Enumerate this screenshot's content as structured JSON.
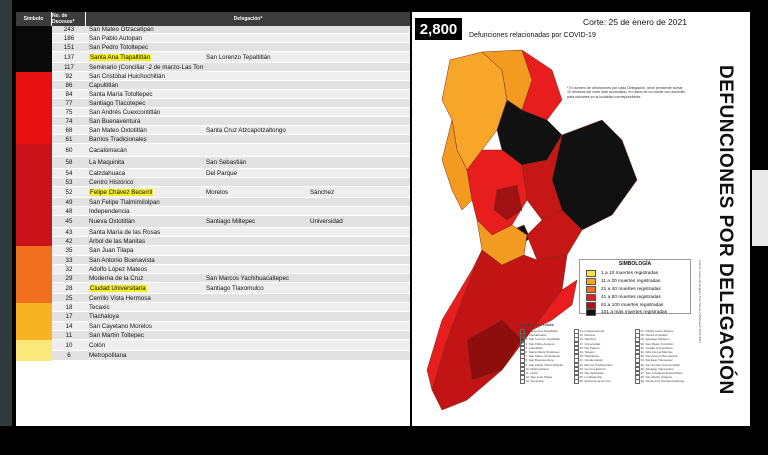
{
  "table": {
    "headers": [
      "Símbolo",
      "No. de Decesos*",
      "Delegación*"
    ],
    "rows": [
      {
        "n": "243",
        "c": [
          "San Mateo Otzacatipan",
          "",
          ""
        ]
      },
      {
        "n": "186",
        "c": [
          "San Pablo Autopan",
          "",
          ""
        ]
      },
      {
        "n": "151",
        "c": [
          "San Pedro Totoltepec",
          "",
          ""
        ]
      },
      {
        "n": "137",
        "c": [
          "Santa Ana Tlapaltitlán",
          "San Lorenzo Tepaltitlán",
          ""
        ],
        "hl": 0
      },
      {
        "n": "117",
        "c": [
          "Seminario (Conciliar -2 de marzo-Las Torres)",
          "",
          ""
        ]
      },
      {
        "n": "92",
        "c": [
          "San Cristóbal Huichochitlán",
          "",
          ""
        ]
      },
      {
        "n": "86",
        "c": [
          "Capultitlán",
          "",
          ""
        ]
      },
      {
        "n": "84",
        "c": [
          "Santa María Totoltepec",
          "",
          ""
        ]
      },
      {
        "n": "77",
        "c": [
          "Santiago Tlacotepec",
          "",
          ""
        ]
      },
      {
        "n": "75",
        "c": [
          "San Andrés Cuexcontitlán",
          "",
          ""
        ]
      },
      {
        "n": "74",
        "c": [
          "San Buenaventura",
          "",
          ""
        ]
      },
      {
        "n": "68",
        "c": [
          "San Mateo Oxtotitlán",
          "Santa Cruz Atzcapotzaltongo",
          ""
        ]
      },
      {
        "n": "61",
        "c": [
          "Barrios Tradicionales",
          "",
          ""
        ]
      },
      {
        "n": "60",
        "c": [
          "Cacalomacán",
          "",
          ""
        ]
      },
      {
        "n": "58",
        "c": [
          "La Maquinita",
          "San Sebastián",
          ""
        ]
      },
      {
        "n": "54",
        "c": [
          "Calzdahuaca",
          "Del Parque",
          ""
        ]
      },
      {
        "n": "53",
        "c": [
          "Centro Histórico",
          "",
          ""
        ]
      },
      {
        "n": "52",
        "c": [
          "Felipe Chávez Becerril",
          "Morelos",
          "Sánchez"
        ],
        "hl": 0
      },
      {
        "n": "49",
        "c": [
          "San Felipe Tlalmimilolpan",
          "",
          ""
        ]
      },
      {
        "n": "48",
        "c": [
          "Independencia",
          "",
          ""
        ]
      },
      {
        "n": "45",
        "c": [
          "Nueva Oxtotitlán",
          "Santiago Miltepec",
          "Universidad"
        ]
      },
      {
        "n": "43",
        "c": [
          "Santa María de las Rosas",
          "",
          ""
        ]
      },
      {
        "n": "42",
        "c": [
          "Árbol de las Manitas",
          "",
          ""
        ]
      },
      {
        "n": "35",
        "c": [
          "San Juan Tilapa",
          "",
          ""
        ]
      },
      {
        "n": "33",
        "c": [
          "San Antonio Buenavista",
          "",
          ""
        ]
      },
      {
        "n": "32",
        "c": [
          "Adolfo López Mateos",
          "",
          ""
        ]
      },
      {
        "n": "29",
        "c": [
          "Moderna de la Cruz",
          "San Marcos Yachihuacaltepec",
          ""
        ]
      },
      {
        "n": "28",
        "c": [
          "Ciudad Universitaria",
          "Santiago Tlaxomulco",
          ""
        ],
        "hl": 0
      },
      {
        "n": "25",
        "c": [
          "Cerrillo Vista Hermosa",
          "",
          ""
        ]
      },
      {
        "n": "18",
        "c": [
          "Tecaxic",
          "",
          ""
        ]
      },
      {
        "n": "17",
        "c": [
          "Tlachaloya",
          "",
          ""
        ]
      },
      {
        "n": "14",
        "c": [
          "San Cayetano Morelos",
          "",
          ""
        ]
      },
      {
        "n": "11",
        "c": [
          "San Martín Toltepec",
          "",
          ""
        ]
      },
      {
        "n": "10",
        "c": [
          "Colón",
          "",
          ""
        ]
      },
      {
        "n": "6",
        "c": [
          "Metropolitana",
          "",
          ""
        ]
      }
    ],
    "symbol_colors": [
      "#0a0a0a",
      "#e81010",
      "#c9121a",
      "#f07020",
      "#f7b324",
      "#fae87a"
    ]
  },
  "map": {
    "total": "2,800",
    "corte": "Corte: 25 de enero de 2021",
    "subtitle": "Defunciones relacionadas por COVID-19",
    "vertical_title": "DEFUNCIONES POR DELEGACIÓN",
    "source": "Fuente: Actas del Registro Civil Toluca y Manzana* 2019-2021",
    "note": "* El número de defunciones por cada Delegación, tiene pendiente sumar 10 decesos del corte total acumulado, en razón de no contar con domicilio para ubicarles en la localidad correspondiente."
  },
  "legend": {
    "title": "SIMBOLOGÍA",
    "items": [
      {
        "label": "1 a 10 muertes registradas",
        "color": "#f7e04a"
      },
      {
        "label": "11 a 20 muertes registradas",
        "color": "#f7a62a"
      },
      {
        "label": "21 a 40 muertes registradas",
        "color": "#f37021"
      },
      {
        "label": "41 a 60 muertes registradas",
        "color": "#e81d1d"
      },
      {
        "label": "61 a 100 muertes registradas",
        "color": "#b41212"
      },
      {
        "label": "101 a más muertes registradas",
        "color": "#111111"
      }
    ]
  },
  "index": {
    "title": "Delegaciones Toluca",
    "columns": [
      [
        "1. Santa Ana Tlapaltitlán",
        "2. Calzdahuaca",
        "3. San Lorenzo Tepaltitlán",
        "4. San Pablo Autopan",
        "5. Capultitlán",
        "6. Santa María Totoltepec",
        "7. San Mateo Otzacatipan",
        "8. San Buenaventura",
        "9. San Felipe Tlalmimilolpan",
        "10. Metropolitana",
        "11. Colón",
        "12. San Juan Tilapa",
        "13. Seminario"
      ],
      [
        "14. Independencia",
        "15. Morelos",
        "16. Sánchez",
        "17. Universidad",
        "18. Del Parque",
        "19. Tecaxic",
        "20. Tlachaloya",
        "21. Cacalomacán",
        "22. Barrios Tradicionales",
        "23. Centro Histórico",
        "24. San Sebastián",
        "25. La Maquinita",
        "26. Moderna de la Cruz"
      ],
      [
        "27. Adolfo López Mateos",
        "28. Nueva Oxtotitlán",
        "29. Santiago Miltepec",
        "30. San Mateo Oxtotitlán",
        "31. Ciudad Universitaria",
        "32. Árbol de las Manitas",
        "33. San Antonio Buenavista",
        "34. Santiago Tlacotepec",
        "35. San Andrés Cuexcontitlán",
        "36. Santiago Tlaxomulco",
        "37. San Cristóbal Huichochitlán",
        "38. San Martín Toltepec",
        "39. Santa Cruz Atzcapotzaltongo"
      ]
    ]
  }
}
